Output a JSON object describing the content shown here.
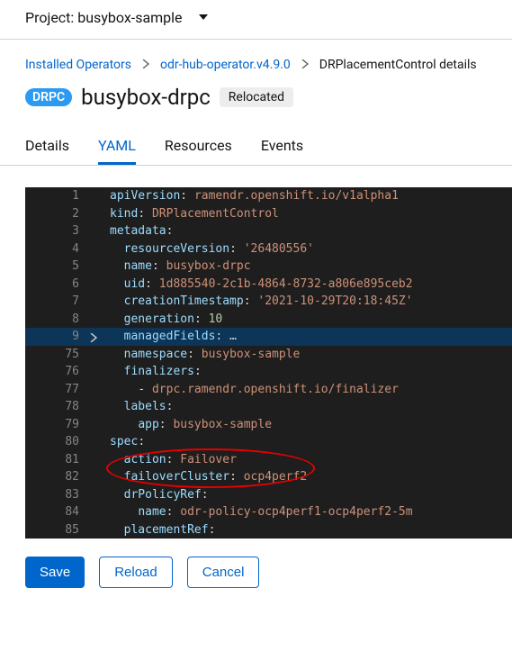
{
  "project_bar": {
    "label": "Project: busybox-sample"
  },
  "breadcrumb": {
    "items": [
      {
        "label": "Installed Operators",
        "link": true
      },
      {
        "label": "odr-hub-operator.v4.9.0",
        "link": true
      },
      {
        "label": "DRPlacementControl details",
        "link": false
      }
    ]
  },
  "title": {
    "kind_badge": "DRPC",
    "name": "busybox-drpc",
    "status_badge": "Relocated"
  },
  "tabs": [
    "Details",
    "YAML",
    "Resources",
    "Events"
  ],
  "active_tab": 1,
  "actions": {
    "save": "Save",
    "reload": "Reload",
    "cancel": "Cancel"
  },
  "yaml_lines": [
    {
      "n": 1,
      "seg": [
        [
          "key",
          "apiVersion"
        ],
        [
          "punc",
          ": "
        ],
        [
          "str",
          "ramendr.openshift.io/v1alpha1"
        ]
      ]
    },
    {
      "n": 2,
      "seg": [
        [
          "key",
          "kind"
        ],
        [
          "punc",
          ": "
        ],
        [
          "str",
          "DRPlacementControl"
        ]
      ]
    },
    {
      "n": 3,
      "seg": [
        [
          "key",
          "metadata"
        ],
        [
          "punc",
          ":"
        ]
      ]
    },
    {
      "n": 4,
      "indent": 1,
      "seg": [
        [
          "key",
          "resourceVersion"
        ],
        [
          "punc",
          ": "
        ],
        [
          "str",
          "'26480556'"
        ]
      ]
    },
    {
      "n": 5,
      "indent": 1,
      "seg": [
        [
          "key",
          "name"
        ],
        [
          "punc",
          ": "
        ],
        [
          "str",
          "busybox-drpc"
        ]
      ]
    },
    {
      "n": 6,
      "indent": 1,
      "seg": [
        [
          "key",
          "uid"
        ],
        [
          "punc",
          ": "
        ],
        [
          "str",
          "1d885540-2c1b-4864-8732-a806e895ceb2"
        ]
      ]
    },
    {
      "n": 7,
      "indent": 1,
      "seg": [
        [
          "key",
          "creationTimestamp"
        ],
        [
          "punc",
          ": "
        ],
        [
          "str",
          "'2021-10-29T20:18:45Z'"
        ]
      ]
    },
    {
      "n": 8,
      "indent": 1,
      "seg": [
        [
          "key",
          "generation"
        ],
        [
          "punc",
          ": "
        ],
        [
          "num",
          "10"
        ]
      ]
    },
    {
      "n": 9,
      "indent": 1,
      "folded": true,
      "fold_expand": true,
      "seg": [
        [
          "key",
          "managedFields"
        ],
        [
          "punc",
          ": "
        ],
        [
          "punc",
          "…"
        ]
      ]
    },
    {
      "n": 75,
      "indent": 1,
      "seg": [
        [
          "key",
          "namespace"
        ],
        [
          "punc",
          ": "
        ],
        [
          "str",
          "busybox-sample"
        ]
      ]
    },
    {
      "n": 76,
      "indent": 1,
      "seg": [
        [
          "key",
          "finalizers"
        ],
        [
          "punc",
          ":"
        ]
      ]
    },
    {
      "n": 77,
      "indent": 2,
      "seg": [
        [
          "punc",
          "- "
        ],
        [
          "str",
          "drpc.ramendr.openshift.io/finalizer"
        ]
      ]
    },
    {
      "n": 78,
      "indent": 1,
      "seg": [
        [
          "key",
          "labels"
        ],
        [
          "punc",
          ":"
        ]
      ]
    },
    {
      "n": 79,
      "indent": 2,
      "seg": [
        [
          "key",
          "app"
        ],
        [
          "punc",
          ": "
        ],
        [
          "str",
          "busybox-sample"
        ]
      ]
    },
    {
      "n": 80,
      "seg": [
        [
          "key",
          "spec"
        ],
        [
          "punc",
          ":"
        ]
      ]
    },
    {
      "n": 81,
      "indent": 1,
      "seg": [
        [
          "key",
          "action"
        ],
        [
          "punc",
          ": "
        ],
        [
          "str",
          "Failover"
        ]
      ]
    },
    {
      "n": 82,
      "indent": 1,
      "seg": [
        [
          "key",
          "failoverCluster"
        ],
        [
          "punc",
          ": "
        ],
        [
          "str",
          "ocp4perf2"
        ]
      ]
    },
    {
      "n": 83,
      "indent": 1,
      "seg": [
        [
          "key",
          "drPolicyRef"
        ],
        [
          "punc",
          ":"
        ]
      ]
    },
    {
      "n": 84,
      "indent": 2,
      "seg": [
        [
          "key",
          "name"
        ],
        [
          "punc",
          ": "
        ],
        [
          "str",
          "odr-policy-ocp4perf1-ocp4perf2-5m"
        ]
      ]
    },
    {
      "n": 85,
      "indent": 1,
      "seg": [
        [
          "key",
          "placementRef"
        ],
        [
          "punc",
          ":"
        ]
      ]
    }
  ],
  "annotation": {
    "highlight_lines": [
      81,
      82
    ]
  }
}
